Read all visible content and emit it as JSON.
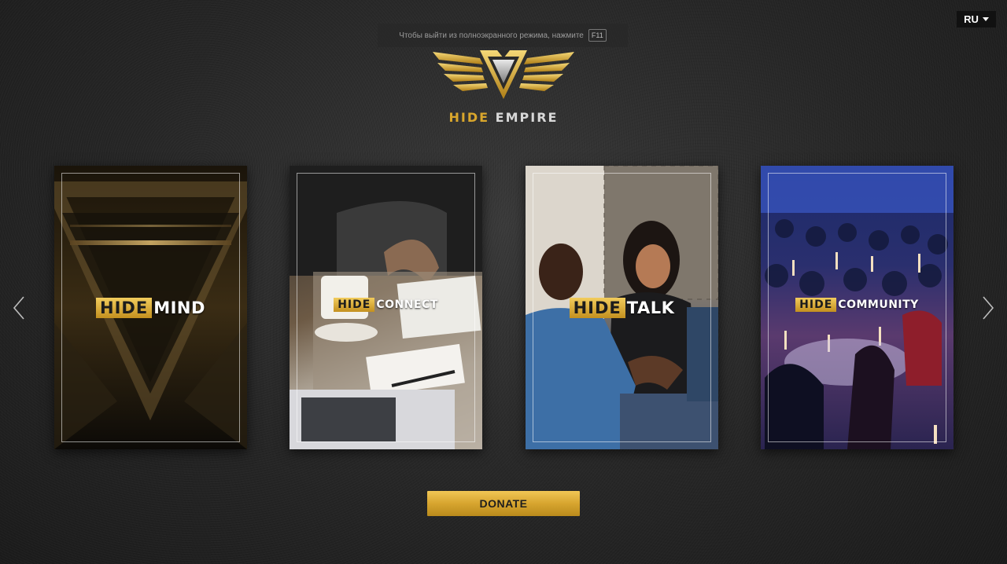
{
  "fullscreen_hint": {
    "text": "Чтобы выйти из полноэкранного режима, нажмите",
    "key": "F11"
  },
  "language": {
    "selected": "RU"
  },
  "logo": {
    "word_gold": "HIDE",
    "word_silver": "EMPIRE"
  },
  "cards": [
    {
      "prefix": "HIDE",
      "word": "MIND"
    },
    {
      "prefix": "HIDE",
      "word": "CONNECT"
    },
    {
      "prefix": "HIDE",
      "word": "TALK"
    },
    {
      "prefix": "HIDE",
      "word": "COMMUNITY"
    }
  ],
  "donate": {
    "label": "DONATE"
  },
  "icons": {
    "prev": "chevron-left-icon",
    "next": "chevron-right-icon",
    "lang": "caret-down-icon"
  },
  "colors": {
    "gold": "#d9a62c",
    "background": "#262626"
  }
}
